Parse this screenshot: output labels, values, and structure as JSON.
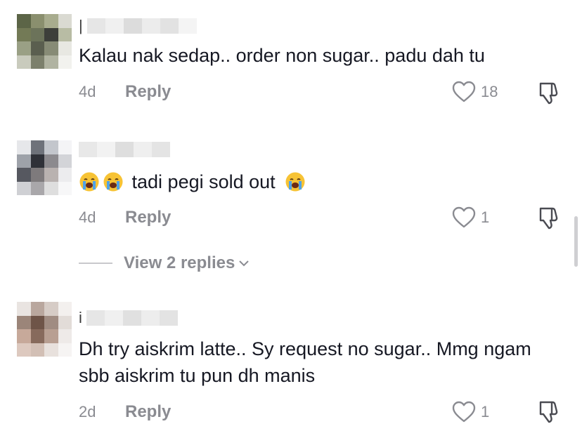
{
  "comments": [
    {
      "name_visible": "|",
      "text": "Kalau nak sedap.. order non sugar.. padu dah tu",
      "emojis_before": 0,
      "time": "4d",
      "reply_label": "Reply",
      "likes": "18",
      "avatar_colors": [
        "#5c6547",
        "#8a8f6e",
        "#a8ac8e",
        "#dadad2",
        "#737a56",
        "#6c735a",
        "#3d3f3a",
        "#b8bca4",
        "#9aa085",
        "#5a5e4f",
        "#878b76",
        "#e8e8e2",
        "#c9cbbd",
        "#7c806c",
        "#b0b3a1",
        "#f2f2ee"
      ]
    },
    {
      "name_visible": "",
      "text": "tadi pegi sold out",
      "emojis_before": 2,
      "emoji_after": true,
      "emoji_name": "loudly-crying-face-icon",
      "time": "4d",
      "reply_label": "Reply",
      "likes": "1",
      "view_replies": "View 2 replies",
      "avatar_colors": [
        "#e6e7ea",
        "#6e727a",
        "#c3c6cc",
        "#f4f4f6",
        "#9ea2a9",
        "#2f3138",
        "#8c8a8e",
        "#d3d4d8",
        "#565860",
        "#7e7a7c",
        "#b9b2b0",
        "#ececee",
        "#cfd0d4",
        "#a9a7aa",
        "#dedede",
        "#f7f7f8"
      ]
    },
    {
      "name_visible": "i",
      "text": "Dh try aiskrim latte.. Sy request no sugar.. Mmg ngam sbb aiskrim tu pun dh manis",
      "emojis_before": 0,
      "time": "2d",
      "reply_label": "Reply",
      "likes": "1",
      "avatar_colors": [
        "#e9e4e1",
        "#b9a79e",
        "#d6ccc6",
        "#f3f0ee",
        "#9b8579",
        "#6e5448",
        "#a08c82",
        "#e2dcd8",
        "#c7a99a",
        "#876a5c",
        "#b89f92",
        "#eeeae8",
        "#ddc9bf",
        "#d2bfb5",
        "#e8e1dd",
        "#f6f4f3"
      ]
    }
  ],
  "colors": {
    "text": "#161823",
    "meta": "#8a8b91",
    "background": "#ffffff"
  }
}
